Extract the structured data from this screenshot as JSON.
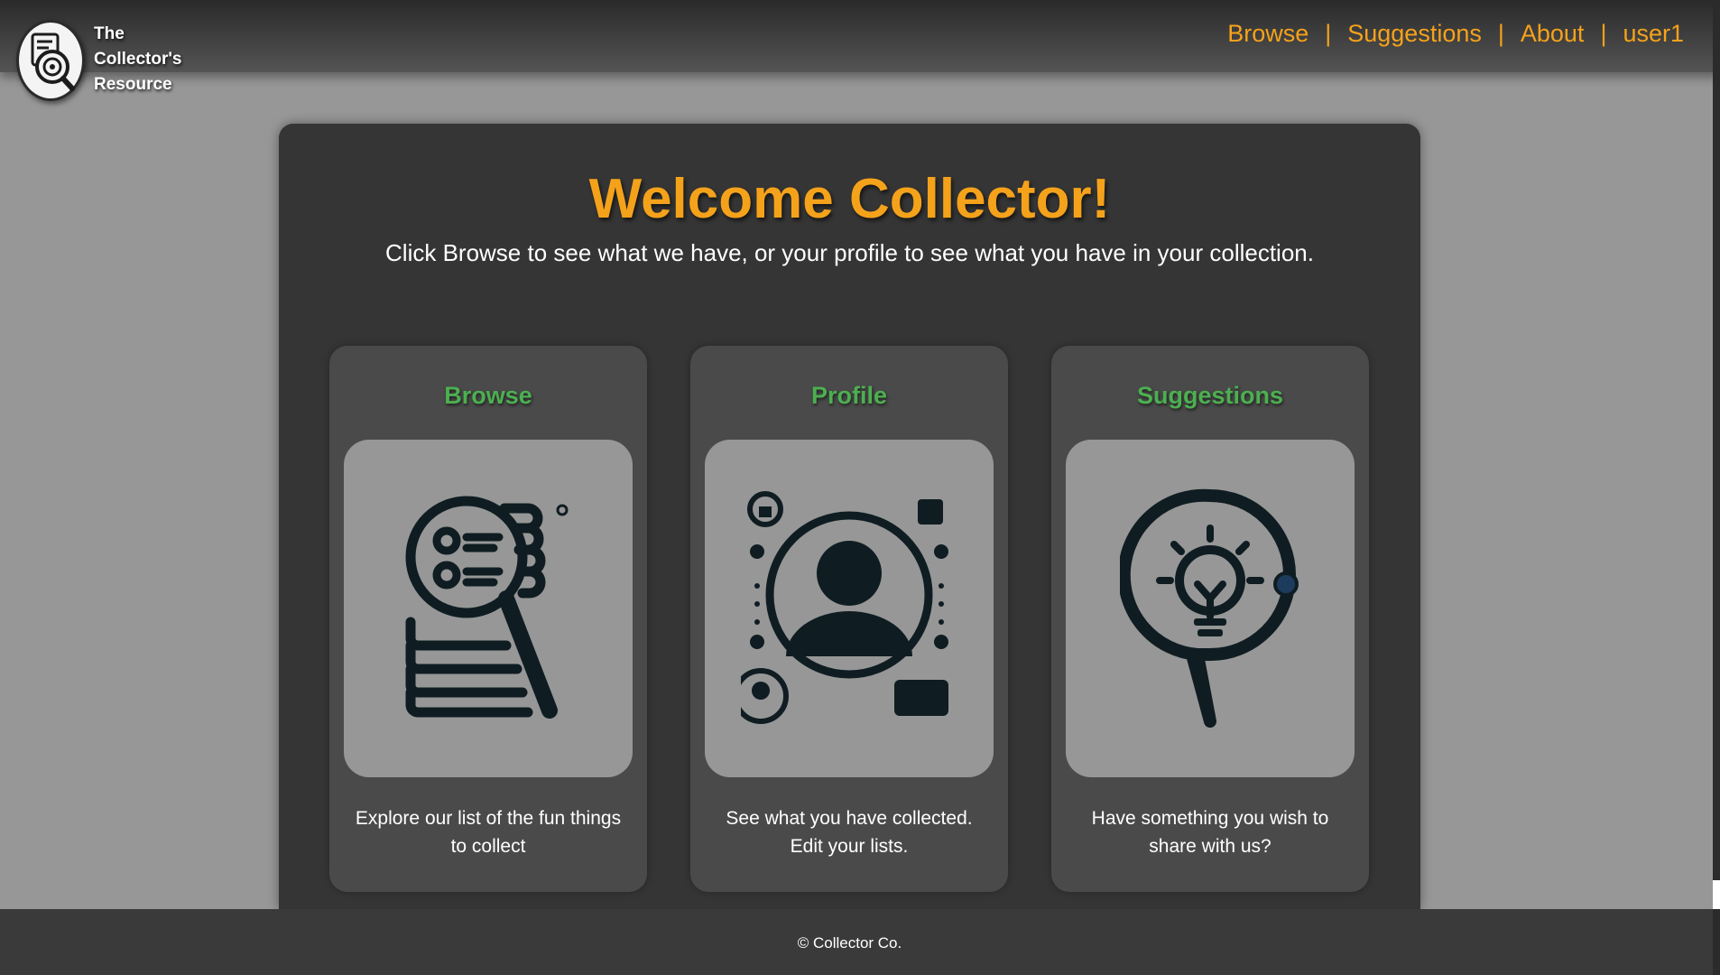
{
  "brand": {
    "line1": "The",
    "line2": "Collector's",
    "line3": "Resource"
  },
  "nav": {
    "items": [
      {
        "label": "Browse"
      },
      {
        "label": "Suggestions"
      },
      {
        "label": "About"
      },
      {
        "label": "user1"
      }
    ],
    "separator": "|"
  },
  "main": {
    "title": "Welcome Collector!",
    "subtitle": "Click Browse to see what we have, or your profile to see what you have in your collection.",
    "cards": [
      {
        "title": "Browse",
        "description": "Explore our list of the fun things to collect",
        "icon": "search-list-icon"
      },
      {
        "title": "Profile",
        "description": "See what you have collected. Edit your lists.",
        "icon": "user-profile-icon"
      },
      {
        "title": "Suggestions",
        "description": "Have something you wish to share with us?",
        "icon": "lightbulb-icon"
      }
    ]
  },
  "footer": {
    "copyright": "© Collector Co."
  },
  "colors": {
    "accent": "#f5a21b",
    "card_title": "#4caf50",
    "background": "#979797",
    "panel": "#353535"
  }
}
